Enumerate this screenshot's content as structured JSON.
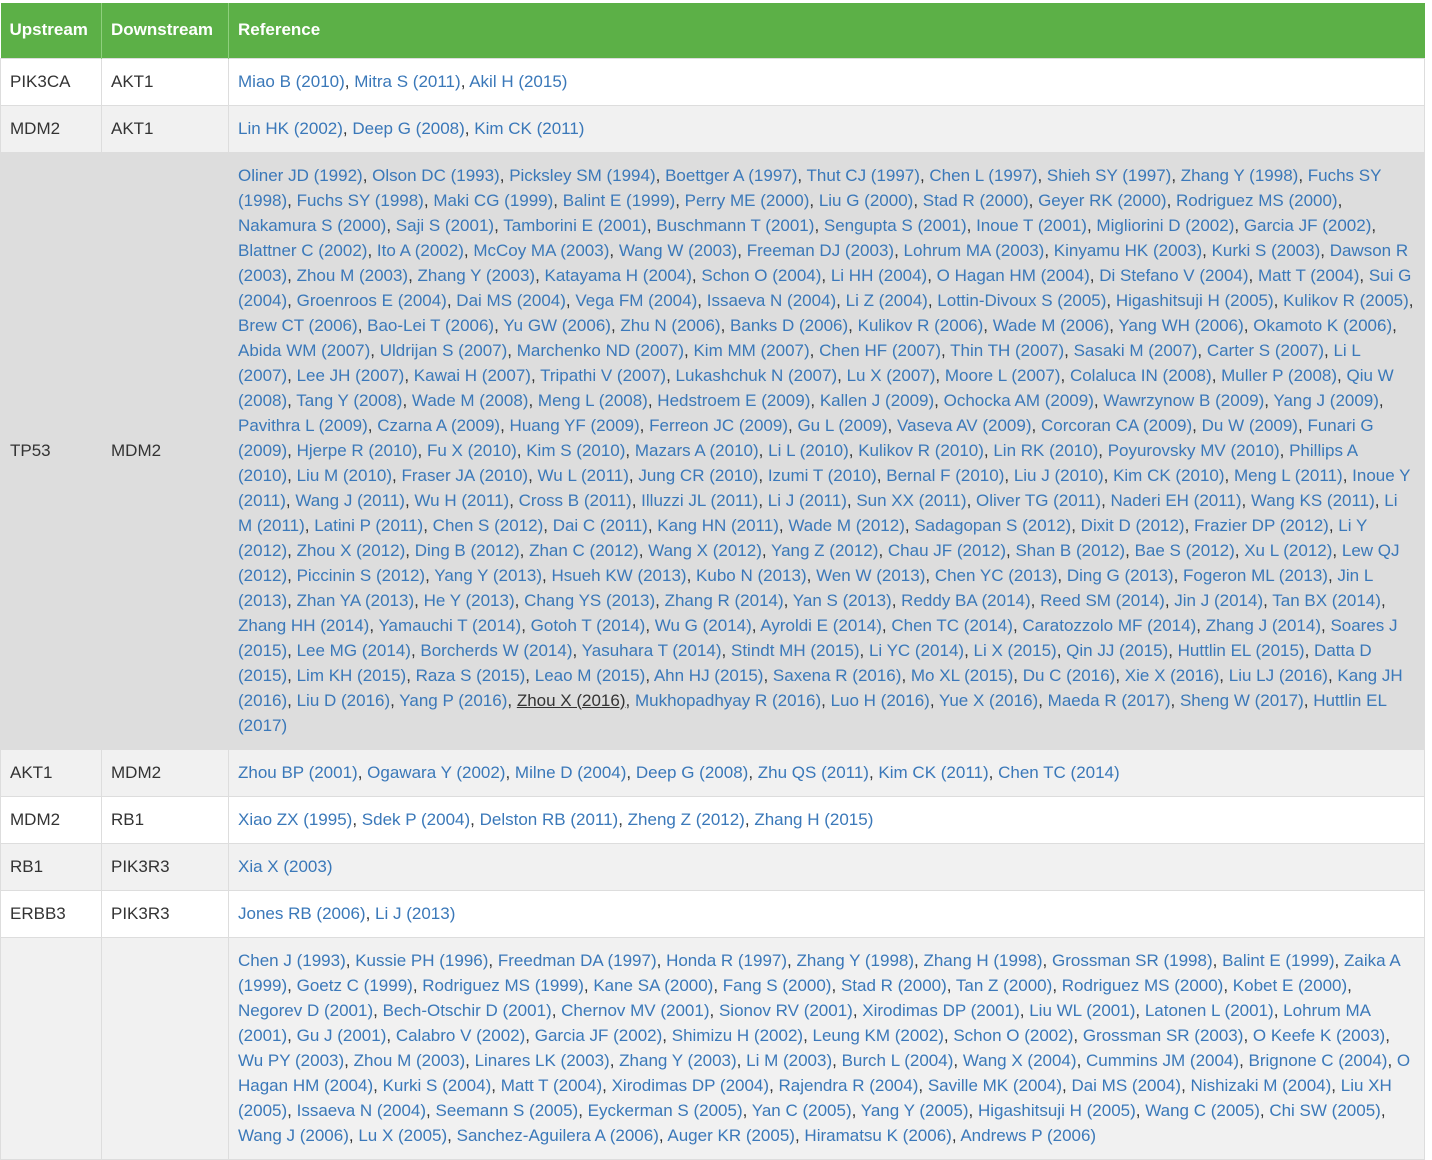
{
  "table": {
    "headers": {
      "upstream": "Upstream",
      "downstream": "Downstream",
      "reference": "Reference"
    },
    "rows": [
      {
        "upstream": "PIK3CA",
        "downstream": "AKT1",
        "refs": [
          "Miao B (2010)",
          "Mitra S (2011)",
          "Akil H (2015)"
        ]
      },
      {
        "upstream": "MDM2",
        "downstream": "AKT1",
        "refs": [
          "Lin HK (2002)",
          "Deep G (2008)",
          "Kim CK (2011)"
        ]
      },
      {
        "upstream": "TP53",
        "downstream": "MDM2",
        "highlighted": true,
        "focused_ref": "Zhou X (2016)",
        "refs": [
          "Oliner JD (1992)",
          "Olson DC (1993)",
          "Picksley SM (1994)",
          "Boettger A (1997)",
          "Thut CJ (1997)",
          "Chen L (1997)",
          "Shieh SY (1997)",
          "Zhang Y (1998)",
          "Fuchs SY (1998)",
          "Fuchs SY (1998)",
          "Maki CG (1999)",
          "Balint E (1999)",
          "Perry ME (2000)",
          "Liu G (2000)",
          "Stad R (2000)",
          "Geyer RK (2000)",
          "Rodriguez MS (2000)",
          "Nakamura S (2000)",
          "Saji S (2001)",
          "Tamborini E (2001)",
          "Buschmann T (2001)",
          "Sengupta S (2001)",
          "Inoue T (2001)",
          "Migliorini D (2002)",
          "Garcia JF (2002)",
          "Blattner C (2002)",
          "Ito A (2002)",
          "McCoy MA (2003)",
          "Wang W (2003)",
          "Freeman DJ (2003)",
          "Lohrum MA (2003)",
          "Kinyamu HK (2003)",
          "Kurki S (2003)",
          "Dawson R (2003)",
          "Zhou M (2003)",
          "Zhang Y (2003)",
          "Katayama H (2004)",
          "Schon O (2004)",
          "Li HH (2004)",
          "O Hagan HM (2004)",
          "Di Stefano V (2004)",
          "Matt T (2004)",
          "Sui G (2004)",
          "Groenroos E (2004)",
          "Dai MS (2004)",
          "Vega FM (2004)",
          "Issaeva N (2004)",
          "Li Z (2004)",
          "Lottin-Divoux S (2005)",
          "Higashitsuji H (2005)",
          "Kulikov R (2005)",
          "Brew CT (2006)",
          "Bao-Lei T (2006)",
          "Yu GW (2006)",
          "Zhu N (2006)",
          "Banks D (2006)",
          "Kulikov R (2006)",
          "Wade M (2006)",
          "Yang WH (2006)",
          "Okamoto K (2006)",
          "Abida WM (2007)",
          "Uldrijan S (2007)",
          "Marchenko ND (2007)",
          "Kim MM (2007)",
          "Chen HF (2007)",
          "Thin TH (2007)",
          "Sasaki M (2007)",
          "Carter S (2007)",
          "Li L (2007)",
          "Lee JH (2007)",
          "Kawai H (2007)",
          "Tripathi V (2007)",
          "Lukashchuk N (2007)",
          "Lu X (2007)",
          "Moore L (2007)",
          "Colaluca IN (2008)",
          "Muller P (2008)",
          "Qiu W (2008)",
          "Tang Y (2008)",
          "Wade M (2008)",
          "Meng L (2008)",
          "Hedstroem E (2009)",
          "Kallen J (2009)",
          "Ochocka AM (2009)",
          "Wawrzynow B (2009)",
          "Yang J (2009)",
          "Pavithra L (2009)",
          "Czarna A (2009)",
          "Huang YF (2009)",
          "Ferreon JC (2009)",
          "Gu L (2009)",
          "Vaseva AV (2009)",
          "Corcoran CA (2009)",
          "Du W (2009)",
          "Funari G (2009)",
          "Hjerpe R (2010)",
          "Fu X (2010)",
          "Kim S (2010)",
          "Mazars A (2010)",
          "Li L (2010)",
          "Kulikov R (2010)",
          "Lin RK (2010)",
          "Poyurovsky MV (2010)",
          "Phillips A (2010)",
          "Liu M (2010)",
          "Fraser JA (2010)",
          "Wu L (2011)",
          "Jung CR (2010)",
          "Izumi T (2010)",
          "Bernal F (2010)",
          "Liu J (2010)",
          "Kim CK (2010)",
          "Meng L (2011)",
          "Inoue Y (2011)",
          "Wang J (2011)",
          "Wu H (2011)",
          "Cross B (2011)",
          "Illuzzi JL (2011)",
          "Li J (2011)",
          "Sun XX (2011)",
          "Oliver TG (2011)",
          "Naderi EH (2011)",
          "Wang KS (2011)",
          "Li M (2011)",
          "Latini P (2011)",
          "Chen S (2012)",
          "Dai C (2011)",
          "Kang HN (2011)",
          "Wade M (2012)",
          "Sadagopan S (2012)",
          "Dixit D (2012)",
          "Frazier DP (2012)",
          "Li Y (2012)",
          "Zhou X (2012)",
          "Ding B (2012)",
          "Zhan C (2012)",
          "Wang X (2012)",
          "Yang Z (2012)",
          "Chau JF (2012)",
          "Shan B (2012)",
          "Bae S (2012)",
          "Xu L (2012)",
          "Lew QJ (2012)",
          "Piccinin S (2012)",
          "Yang Y (2013)",
          "Hsueh KW (2013)",
          "Kubo N (2013)",
          "Wen W (2013)",
          "Chen YC (2013)",
          "Ding G (2013)",
          "Fogeron ML (2013)",
          "Jin L (2013)",
          "Zhan YA (2013)",
          "He Y (2013)",
          "Chang YS (2013)",
          "Zhang R (2014)",
          "Yan S (2013)",
          "Reddy BA (2014)",
          "Reed SM (2014)",
          "Jin J (2014)",
          "Tan BX (2014)",
          "Zhang HH (2014)",
          "Yamauchi T (2014)",
          "Gotoh T (2014)",
          "Wu G (2014)",
          "Ayroldi E (2014)",
          "Chen TC (2014)",
          "Caratozzolo MF (2014)",
          "Zhang J (2014)",
          "Soares J (2015)",
          "Lee MG (2014)",
          "Borcherds W (2014)",
          "Yasuhara T (2014)",
          "Stindt MH (2015)",
          "Li YC (2014)",
          "Li X (2015)",
          "Qin JJ (2015)",
          "Huttlin EL (2015)",
          "Datta D (2015)",
          "Lim KH (2015)",
          "Raza S (2015)",
          "Leao M (2015)",
          "Ahn HJ (2015)",
          "Saxena R (2016)",
          "Mo XL (2015)",
          "Du C (2016)",
          "Xie X (2016)",
          "Liu LJ (2016)",
          "Kang JH (2016)",
          "Liu D (2016)",
          "Yang P (2016)",
          "Zhou X (2016)",
          "Mukhopadhyay R (2016)",
          "Luo H (2016)",
          "Yue X (2016)",
          "Maeda R (2017)",
          "Sheng W (2017)",
          "Huttlin EL (2017)"
        ]
      },
      {
        "upstream": "AKT1",
        "downstream": "MDM2",
        "refs": [
          "Zhou BP (2001)",
          "Ogawara Y (2002)",
          "Milne D (2004)",
          "Deep G (2008)",
          "Zhu QS (2011)",
          "Kim CK (2011)",
          "Chen TC (2014)"
        ]
      },
      {
        "upstream": "MDM2",
        "downstream": "RB1",
        "refs": [
          "Xiao ZX (1995)",
          "Sdek P (2004)",
          "Delston RB (2011)",
          "Zheng Z (2012)",
          "Zhang H (2015)"
        ]
      },
      {
        "upstream": "RB1",
        "downstream": "PIK3R3",
        "refs": [
          "Xia X (2003)"
        ]
      },
      {
        "upstream": "ERBB3",
        "downstream": "PIK3R3",
        "refs": [
          "Jones RB (2006)",
          "Li J (2013)"
        ]
      },
      {
        "upstream": "",
        "downstream": "",
        "refs": [
          "Chen J (1993)",
          "Kussie PH (1996)",
          "Freedman DA (1997)",
          "Honda R (1997)",
          "Zhang Y (1998)",
          "Zhang H (1998)",
          "Grossman SR (1998)",
          "Balint E (1999)",
          "Zaika A (1999)",
          "Goetz C (1999)",
          "Rodriguez MS (1999)",
          "Kane SA (2000)",
          "Fang S (2000)",
          "Stad R (2000)",
          "Tan Z (2000)",
          "Rodriguez MS (2000)",
          "Kobet E (2000)",
          "Negorev D (2001)",
          "Bech-Otschir D (2001)",
          "Chernov MV (2001)",
          "Sionov RV (2001)",
          "Xirodimas DP (2001)",
          "Liu WL (2001)",
          "Latonen L (2001)",
          "Lohrum MA (2001)",
          "Gu J (2001)",
          "Calabro V (2002)",
          "Garcia JF (2002)",
          "Shimizu H (2002)",
          "Leung KM (2002)",
          "Schon O (2002)",
          "Grossman SR (2003)",
          "O Keefe K (2003)",
          "Wu PY (2003)",
          "Zhou M (2003)",
          "Linares LK (2003)",
          "Zhang Y (2003)",
          "Li M (2003)",
          "Burch L (2004)",
          "Wang X (2004)",
          "Cummins JM (2004)",
          "Brignone C (2004)",
          "O Hagan HM (2004)",
          "Kurki S (2004)",
          "Matt T (2004)",
          "Xirodimas DP (2004)",
          "Rajendra R (2004)",
          "Saville MK (2004)",
          "Dai MS (2004)",
          "Nishizaki M (2004)",
          "Liu XH (2005)",
          "Issaeva N (2004)",
          "Seemann S (2005)",
          "Eyckerman S (2005)",
          "Yan C (2005)",
          "Yang Y (2005)",
          "Higashitsuji H (2005)",
          "Wang C (2005)",
          "Chi SW (2005)",
          "Wang J (2006)",
          "Lu X (2005)",
          "Sanchez-Aguilera A (2006)",
          "Auger KR (2005)",
          "Hiramatsu K (2006)",
          "Andrews P (2006)"
        ]
      }
    ]
  }
}
